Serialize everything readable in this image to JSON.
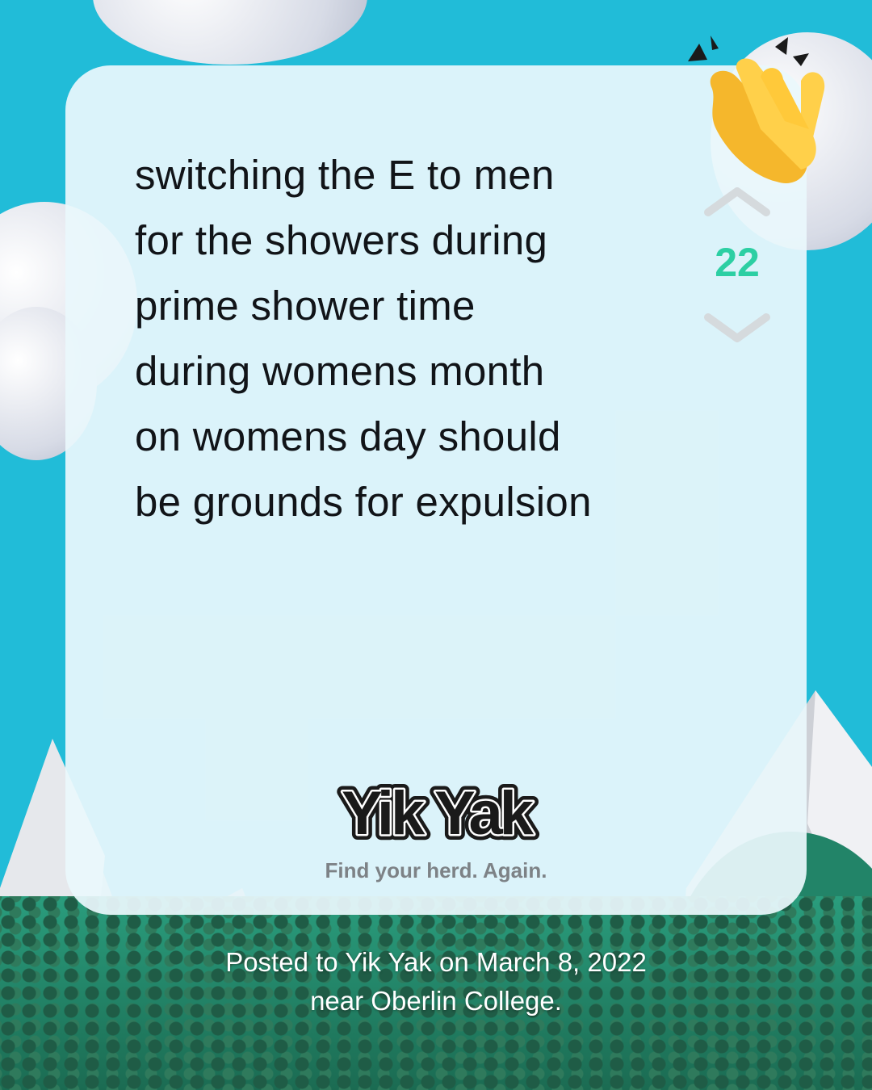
{
  "post": {
    "lines": [
      "switching the E to men",
      "for the showers during",
      "prime shower time",
      "during womens month",
      "on womens day should",
      "be grounds for expulsion"
    ]
  },
  "votes": {
    "count": "22",
    "up_icon": "chevron-up-icon",
    "down_icon": "chevron-down-icon"
  },
  "reaction": {
    "icon": "clapping-hands-icon"
  },
  "brand": {
    "logo_text": "Yik Yak",
    "tagline": "Find your herd. Again."
  },
  "caption": {
    "line1": "Posted to Yik Yak on March 8, 2022",
    "line2": "near Oberlin College."
  },
  "colors": {
    "background": "#21bcd8",
    "vote_count": "#2ccfa3",
    "card": "#eaf7fc",
    "text": "#111418"
  }
}
